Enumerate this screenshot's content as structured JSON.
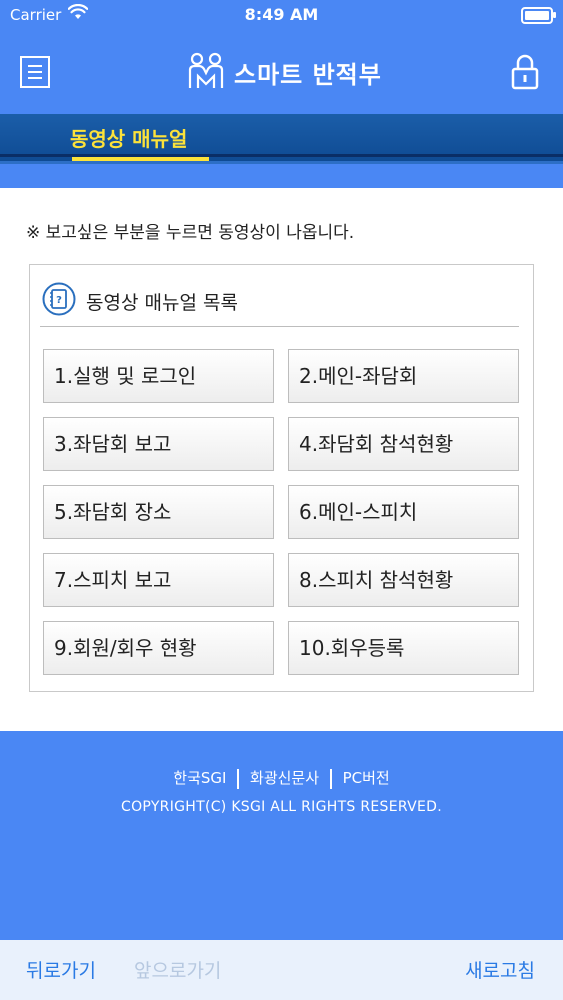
{
  "status_bar": {
    "carrier": "Carrier",
    "time": "8:49 AM",
    "wifi_icon": "wifi-icon",
    "battery_icon": "battery-icon"
  },
  "header": {
    "title": "스마트 반적부",
    "menu_icon": "hamburger-icon",
    "logo_icon": "people-logo-icon",
    "lock_icon": "lock-icon"
  },
  "tab": {
    "label": "동영상 매뉴얼"
  },
  "notice": "※ 보고싶은 부분을 누르면 동영상이 나옵니다.",
  "panel": {
    "title": "동영상 매뉴얼 목록",
    "icon": "manual-book-icon",
    "items": [
      "1.실행 및 로그인",
      "2.메인-좌담회",
      "3.좌담회 보고",
      "4.좌담회 참석현황",
      "5.좌담회 장소",
      "6.메인-스피치",
      "7.스피치 보고",
      "8.스피치 참석현황",
      "9.회원/회우 현황",
      "10.회우등록"
    ]
  },
  "footer": {
    "links": [
      "한국SGI",
      "화광신문사",
      "PC버전"
    ],
    "copyright": "COPYRIGHT(C) KSGI ALL RIGHTS RESERVED."
  },
  "bottom_bar": {
    "back": "뒤로가기",
    "forward": "앞으로가기",
    "refresh": "새로고침"
  },
  "colors": {
    "primary_blue": "#4a87f4",
    "tab_bar": "#1558a6",
    "tab_accent": "#fce23a",
    "bottom_link": "#2a7ae4",
    "disabled_link": "#b6c8e0"
  }
}
